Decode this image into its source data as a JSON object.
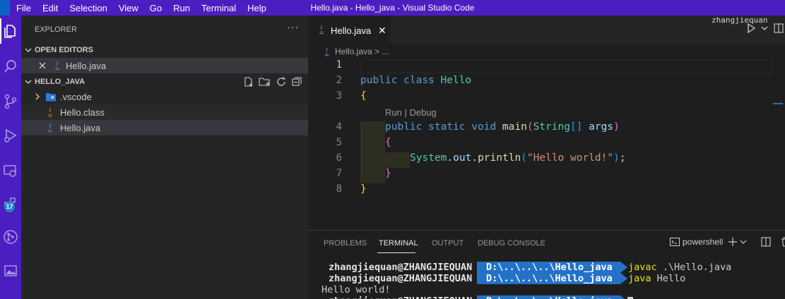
{
  "titlebar": {
    "menu": [
      "File",
      "Edit",
      "Selection",
      "View",
      "Go",
      "Run",
      "Terminal",
      "Help"
    ],
    "title": "Hello.java - Hello_java - Visual Studio Code"
  },
  "activity": {
    "extensions_badge": "17"
  },
  "sidebar": {
    "title": "EXPLORER",
    "more": "···",
    "open_editors": {
      "header": "OPEN EDITORS",
      "items": [
        {
          "name": "Hello.java"
        }
      ]
    },
    "folder": {
      "header": "HELLO_JAVA",
      "items": [
        {
          "name": ".vscode",
          "kind": "folder"
        },
        {
          "name": "Hello.class",
          "kind": "java-file"
        },
        {
          "name": "Hello.java",
          "kind": "java-file"
        }
      ]
    }
  },
  "editor": {
    "watermark": "zhangjiequan",
    "tab": {
      "label": "Hello.java",
      "close": "✕"
    },
    "breadcrumb": "Hello.java > ...",
    "line_numbers": [
      "1",
      "2",
      "3",
      "4",
      "5",
      "6",
      "7",
      "8"
    ],
    "codelens": "Run | Debug",
    "code": {
      "l2_public": "public",
      "l2_class": "class",
      "l2_name": "Hello",
      "l3_brace": "{",
      "l4_public": "public",
      "l4_static": "static",
      "l4_void": "void",
      "l4_main": "main",
      "l4_lparen": "(",
      "l4_string": "String",
      "l4_arr": "[]",
      "l4_args": "args",
      "l4_rparen": ")",
      "l5_brace": "{",
      "l6_system": "System",
      "l6_dot1": ".",
      "l6_out": "out",
      "l6_dot2": ".",
      "l6_println": "println",
      "l6_lparen": "(",
      "l6_str": "\"Hello world!\"",
      "l6_rparen": ")",
      "l6_semi": ";",
      "l7_brace": "}",
      "l8_brace": "}"
    }
  },
  "panel": {
    "tabs": [
      "PROBLEMS",
      "TERMINAL",
      "OUTPUT",
      "DEBUG CONSOLE"
    ],
    "active_tab": "TERMINAL",
    "shell": "powershell",
    "terminal": {
      "user": "zhangjiequan@ZHANGJIEQUAN",
      "path": "D:\\..\\..\\..\\Hello_java",
      "cmd1": "javac",
      "arg1": " .\\Hello.java",
      "cmd2": "java",
      "arg2": " Hello",
      "output": "Hello world!"
    }
  },
  "colors": {
    "titlebar": "#4b1ec2",
    "sidebar": "#252526",
    "editor": "#1e1e1e",
    "prompt_path": "#2472c8",
    "command": "#e5e510"
  }
}
